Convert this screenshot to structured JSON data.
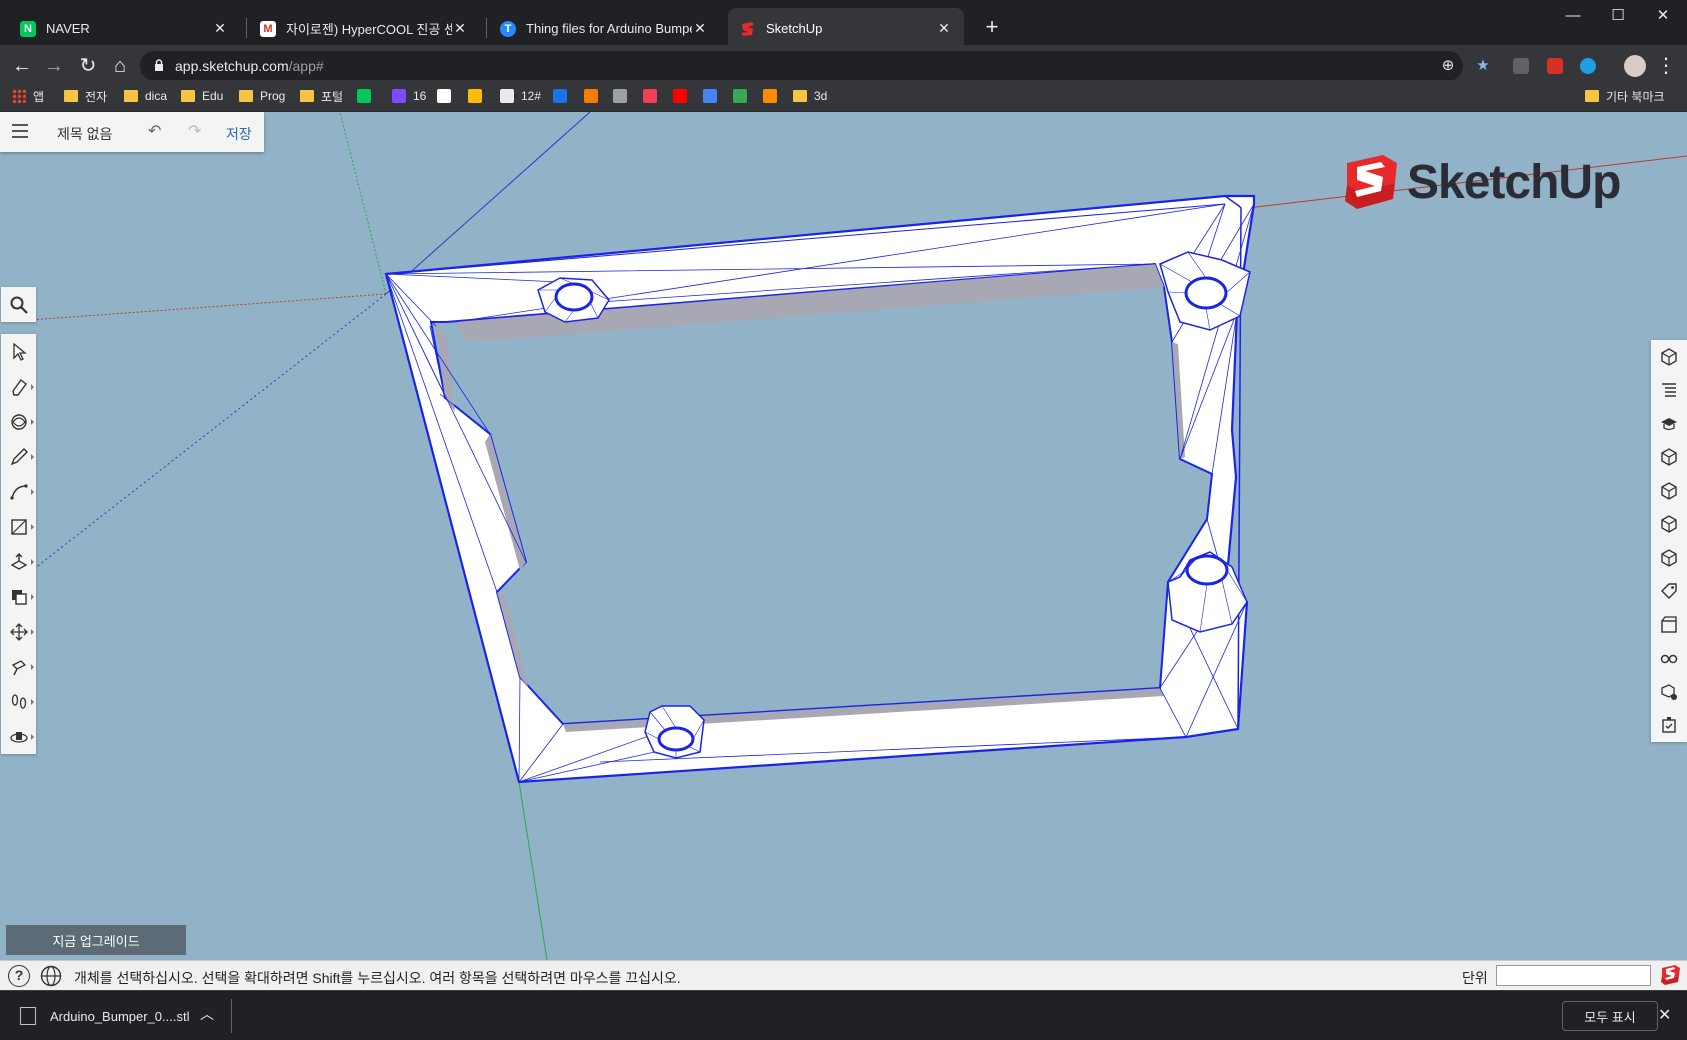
{
  "browser": {
    "tabs": [
      {
        "title": "NAVER",
        "favicon": "naver-icon",
        "color": "#03c75a",
        "glyph": "N"
      },
      {
        "title": "자이로젠) HyperCOOL 진공 센서",
        "favicon": "gmail-icon",
        "color": "#ffffff",
        "glyph": "M"
      },
      {
        "title": "Thing files for Arduino Bumper",
        "favicon": "thingiverse-icon",
        "color": "#248bfb",
        "glyph": "T"
      },
      {
        "title": "SketchUp",
        "favicon": "sketchup-icon",
        "color": "#e72b2d",
        "glyph": ""
      }
    ],
    "active_tab": 3,
    "new_tab": "+",
    "window_controls": {
      "minimize": "—",
      "maximize": "☐",
      "close": "✕"
    },
    "address": {
      "host": "app.sketchup.com",
      "path": "/app#"
    },
    "bookmarks": [
      {
        "label": "앱",
        "icon": "apps-grid-icon"
      },
      {
        "label": "전자",
        "icon": "folder-icon"
      },
      {
        "label": "dica",
        "icon": "folder-icon"
      },
      {
        "label": "Edu",
        "icon": "folder-icon"
      },
      {
        "label": "Prog",
        "icon": "folder-icon"
      },
      {
        "label": "포털",
        "icon": "folder-icon"
      },
      {
        "label": "",
        "icon": "naver-icon"
      },
      {
        "label": "16",
        "icon": "d-icon"
      },
      {
        "label": "",
        "icon": "gmail-icon"
      },
      {
        "label": "",
        "icon": "photos-icon"
      },
      {
        "label": "12#",
        "icon": "dots-icon"
      },
      {
        "label": "",
        "icon": "calendar-28-icon"
      },
      {
        "label": "",
        "icon": "r-icon"
      },
      {
        "label": "",
        "icon": "printer-icon"
      },
      {
        "label": "",
        "icon": "pocket-icon"
      },
      {
        "label": "",
        "icon": "youtube-icon"
      },
      {
        "label": "",
        "icon": "translate-icon"
      },
      {
        "label": "",
        "icon": "maps-icon"
      },
      {
        "label": "",
        "icon": "swirl-icon"
      },
      {
        "label": "3d",
        "icon": "folder-icon"
      }
    ],
    "other_bookmarks": "기타 북마크"
  },
  "app": {
    "doc_title": "제목 없음",
    "save_label": "저장",
    "logo_text": "SketchUp",
    "upgrade_label": "지금 업그레이드",
    "left_tools_top": [
      "search-icon"
    ],
    "left_tools": [
      "select-arrow-icon",
      "eraser-icon",
      "paint-bucket-icon",
      "pencil-icon",
      "arc-icon",
      "rectangle-icon",
      "push-pull-icon",
      "offset-icon",
      "move-icon",
      "tape-measure-icon",
      "walk-icon",
      "orbit-icon"
    ],
    "right_tools": [
      "entity-info-icon",
      "outliner-icon",
      "instructor-icon",
      "materials-icon",
      "components-icon",
      "styles-icon",
      "views-icon",
      "tags-icon",
      "scenes-icon",
      "display-icon",
      "shadows-icon",
      "solid-inspector-icon"
    ],
    "status_message": "개체를 선택하십시오. 선택을 확대하려면 Shift를 누르십시오. 여러 항목을 선택하려면 마우스를 끄십시오.",
    "unit_label": "단위",
    "unit_value": ""
  },
  "downloads": {
    "file": "Arduino_Bumper_0....stl",
    "show_all": "모두 표시"
  },
  "colors": {
    "viewport_bg": "#91b2c7",
    "edge_blue": "#1a24e6",
    "face_white": "#ffffff",
    "face_grey": "#a8a8b4",
    "axis_red": "#c0392b",
    "axis_green": "#2ea84a",
    "axis_blue": "#2a38c9",
    "logo_red": "#e72b2d"
  }
}
